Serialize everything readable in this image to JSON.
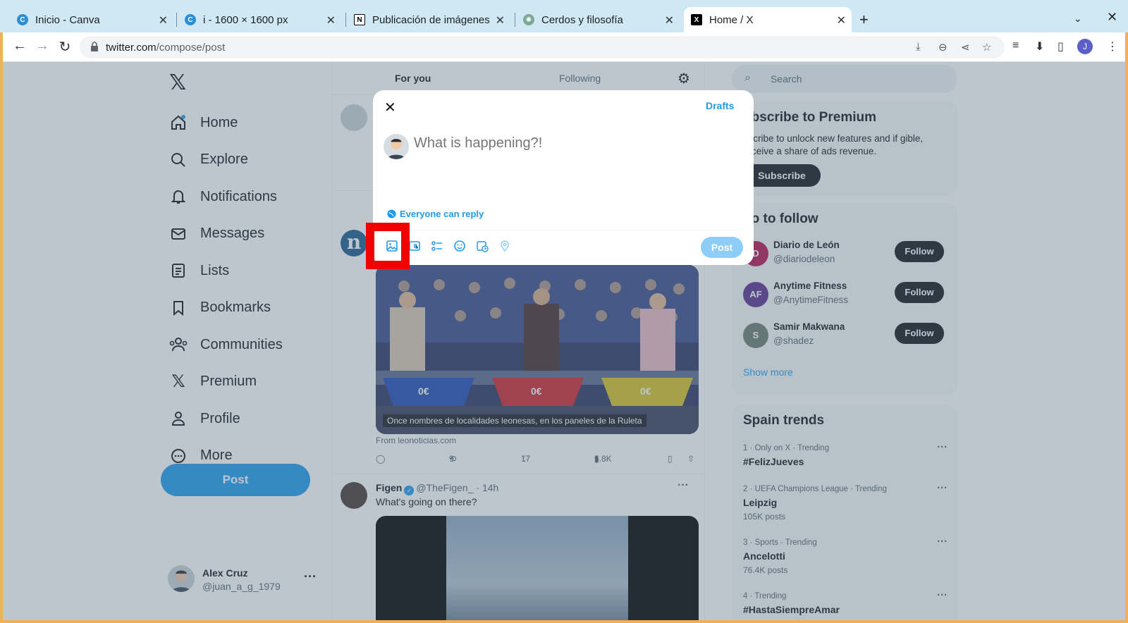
{
  "browser": {
    "tabs": [
      {
        "title": "Inicio - Canva",
        "icon": "canva-icon",
        "active": false
      },
      {
        "title": "i - 1600 × 1600 px",
        "icon": "canva-icon",
        "active": false
      },
      {
        "title": "Publicación de imágenes",
        "icon": "notion-icon",
        "active": false
      },
      {
        "title": "Cerdos y filosofía",
        "icon": "chatgpt-icon",
        "active": false
      },
      {
        "title": "Home / X",
        "icon": "x-icon",
        "active": true
      }
    ],
    "url_host": "twitter.com",
    "url_path": "/compose/post",
    "profile_initial": "J"
  },
  "sidebar": {
    "items": [
      {
        "label": "Home",
        "icon": "home-icon"
      },
      {
        "label": "Explore",
        "icon": "search-icon"
      },
      {
        "label": "Notifications",
        "icon": "bell-icon"
      },
      {
        "label": "Messages",
        "icon": "mail-icon"
      },
      {
        "label": "Lists",
        "icon": "list-icon"
      },
      {
        "label": "Bookmarks",
        "icon": "bookmark-icon"
      },
      {
        "label": "Communities",
        "icon": "people-icon"
      },
      {
        "label": "Premium",
        "icon": "x-icon"
      },
      {
        "label": "Profile",
        "icon": "person-icon"
      },
      {
        "label": "More",
        "icon": "more-circle-icon"
      }
    ],
    "post_label": "Post",
    "account": {
      "name": "Alex Cruz",
      "handle": "@juan_a_g_1979"
    }
  },
  "timeline": {
    "tab_for_you": "For you",
    "tab_following": "Following",
    "media_caption": "Once nombres de localidades leonesas, en los paneles de la Ruleta",
    "from_link": "From leonoticias.com",
    "retweets": "9",
    "likes": "17",
    "views": "5.8K",
    "figen": {
      "name": "Figen",
      "handle": "@TheFigen_",
      "time": "· 14h",
      "text": "What's going on there?"
    }
  },
  "right": {
    "search_placeholder": "Search",
    "premium": {
      "title": "ubscribe to Premium",
      "body": "bscribe to unlock new features and if gible, receive a share of ads revenue.",
      "button": "Subscribe"
    },
    "who_to_follow": {
      "title": "ho to follow",
      "accounts": [
        {
          "name": "Diario de León",
          "handle": "@diariodeleon",
          "color": "#b5134f",
          "initial": "D"
        },
        {
          "name": "Anytime Fitness",
          "handle": "@AnytimeFitness",
          "color": "#5c2d91",
          "initial": "AF"
        },
        {
          "name": "Samir Makwana",
          "handle": "@shadez",
          "color": "#6b7b6e",
          "initial": "S"
        }
      ],
      "follow_label": "Follow",
      "show_more": "Show more"
    },
    "trends": {
      "title": "Spain trends",
      "items": [
        {
          "meta": "1 · Only on X · Trending",
          "name": "#FelizJueves",
          "count": ""
        },
        {
          "meta": "2 · UEFA Champions League · Trending",
          "name": "Leipzig",
          "count": "105K posts"
        },
        {
          "meta": "3 · Sports · Trending",
          "name": "Ancelotti",
          "count": "76.4K posts"
        },
        {
          "meta": "4 · Trending",
          "name": "#HastaSiempreAmar",
          "count": ""
        }
      ]
    }
  },
  "compose": {
    "drafts": "Drafts",
    "placeholder": "What is happening?!",
    "reply_setting": "Everyone can reply",
    "post_label": "Post",
    "tools": [
      "image-icon",
      "gif-icon",
      "poll-icon",
      "emoji-icon",
      "schedule-icon",
      "location-icon"
    ]
  },
  "colors": {
    "accent": "#1d9bf0",
    "highlight": "#f00000",
    "tab_bar": "#cfe8f4",
    "frame": "#efb057"
  }
}
